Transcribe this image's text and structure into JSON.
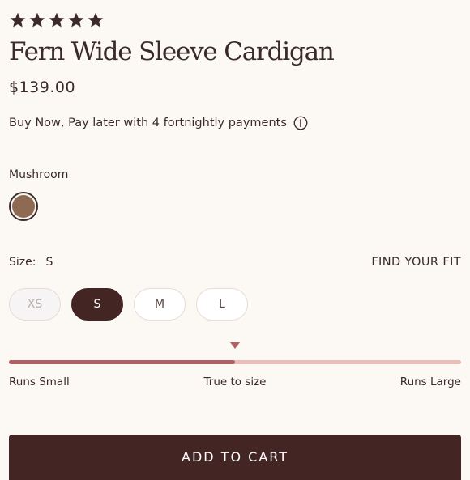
{
  "rating": {
    "value": 5,
    "max": 5
  },
  "product": {
    "name": "Fern Wide Sleeve Cardigan",
    "price": "$139.00"
  },
  "bnpl": {
    "text": "Buy Now, Pay later with 4 fortnightly payments",
    "icon": "info-icon"
  },
  "color": {
    "label": "Mushroom",
    "swatch_hex": "#8e6a52",
    "selected": true
  },
  "size": {
    "label": "Size:",
    "selected_value": "S",
    "find_fit_label": "FIND YOUR FIT",
    "options": [
      {
        "label": "XS",
        "state": "unavailable"
      },
      {
        "label": "S",
        "state": "selected"
      },
      {
        "label": "M",
        "state": "available"
      },
      {
        "label": "L",
        "state": "available"
      }
    ]
  },
  "fit_scale": {
    "labels": [
      "Runs Small",
      "True to size",
      "Runs Large"
    ],
    "value": 0.5,
    "fill_color": "#b35f63",
    "track_color": "#eabdb7"
  },
  "cart": {
    "label": "ADD TO CART",
    "color": "#432523"
  },
  "theme": {
    "background": "#fcf8f3",
    "text": "#3a2b28"
  }
}
